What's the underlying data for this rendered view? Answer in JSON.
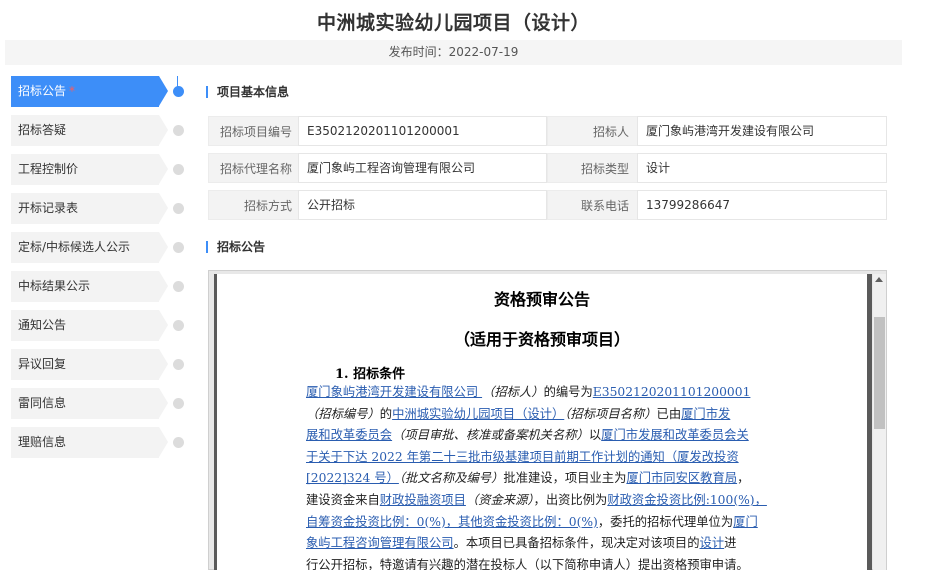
{
  "header": {
    "title": "中洲城实验幼儿园项目（设计）",
    "publish_time": "发布时间：2022-07-19"
  },
  "nav": {
    "items": [
      {
        "label": "招标公告",
        "active": true,
        "required_mark": "*"
      },
      {
        "label": "招标答疑"
      },
      {
        "label": "工程控制价"
      },
      {
        "label": "开标记录表"
      },
      {
        "label": "定标/中标候选人公示"
      },
      {
        "label": "中标结果公示"
      },
      {
        "label": "通知公告"
      },
      {
        "label": "异议回复"
      },
      {
        "label": "雷同信息"
      },
      {
        "label": "理赔信息"
      }
    ]
  },
  "sections": {
    "basic_info": "项目基本信息",
    "announcement": "招标公告"
  },
  "info": {
    "rows": [
      {
        "l1": "招标项目编号",
        "v1": "E3502120201101200001",
        "l2": "招标人",
        "v2": "厦门象屿港湾开发建设有限公司"
      },
      {
        "l1": "招标代理名称",
        "v1": "厦门象屿工程咨询管理有限公司",
        "l2": "招标类型",
        "v2": "设计"
      },
      {
        "l1": "招标方式",
        "v1": "公开招标",
        "l2": "联系电话",
        "v2": "13799286647"
      }
    ]
  },
  "doc": {
    "title": "资格预审公告",
    "subtitle": "（适用于资格预审项目）",
    "section1": "1.  招标条件",
    "lines": [
      [
        "  厦门象屿港湾开发建设有限公司  ",
        "（招标人）",
        "的编号为",
        "E3502120201101200001",
        "",
        "",
        ""
      ],
      [
        "（招标编号）",
        "的",
        "中洲城实验幼儿园项目（设计）",
        "（招标项目名称）",
        "已由",
        "厦门市发",
        ""
      ],
      [
        "展和改革委员会",
        "（项目审批、核准或备案机关名称）",
        "以",
        "厦门市发展和改革委员会关",
        "",
        "",
        ""
      ],
      [
        "于关于下达 2022 年第二十三批市级基建项目前期工作计划的通知（厦发改投资",
        "",
        "",
        "",
        "",
        "",
        ""
      ],
      [
        "[2022]324 号）",
        "（批文名称及编号）",
        "批准建设，项目业主为",
        "厦门市同安区教育局",
        "，",
        "",
        ""
      ],
      [
        "建设资金来自",
        "财政投融资项目",
        "（资金来源）",
        "，出资比例为",
        "财政资金投资比例:100(%)，",
        "",
        ""
      ],
      [
        "自筹资金投资比例：0(%)，其他资金投资比例：0(%)",
        "，委托的招标代理单位为",
        "厦门",
        "",
        "",
        "",
        ""
      ],
      [
        "象屿工程咨询管理有限公司",
        "。本项目已具备招标条件，现决定对该项目的",
        "设计",
        "进",
        "",
        "",
        ""
      ],
      [
        "行公开招标，特邀请有兴趣的潜在投标人（以下简称申请人）提出资格预审申请。",
        "",
        "",
        "",
        "",
        "",
        ""
      ]
    ]
  },
  "colors": {
    "accent": "#3d8ef8",
    "link": "#2a5db0",
    "required": "#ff5a5a"
  }
}
